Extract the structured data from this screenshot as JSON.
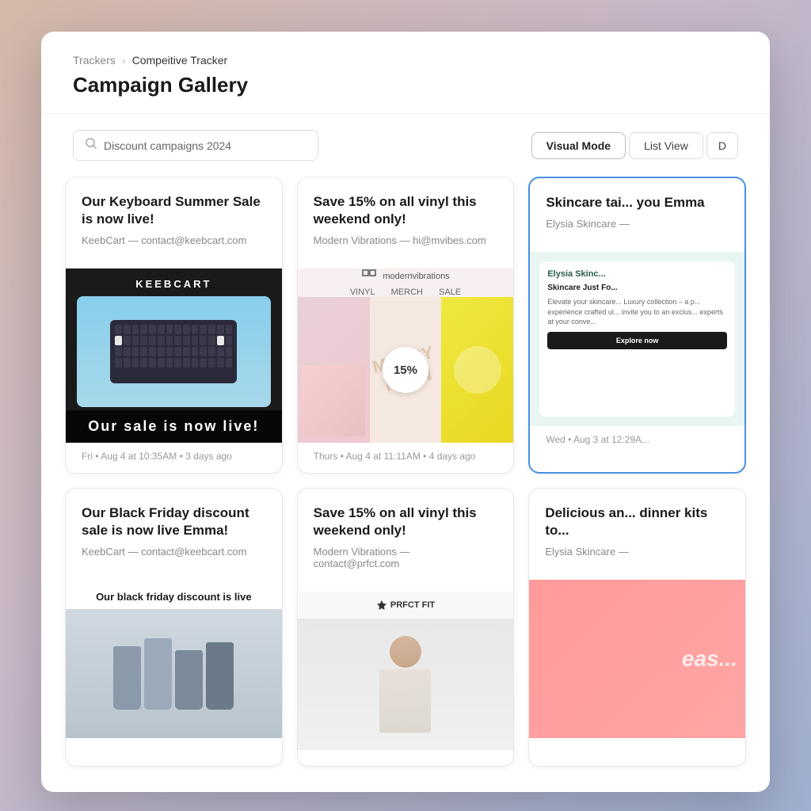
{
  "breadcrumb": {
    "parent": "Trackers",
    "separator": "›",
    "current": "Compeitive Tracker"
  },
  "page": {
    "title": "Campaign Gallery"
  },
  "search": {
    "placeholder": "Discount campaigns 2024",
    "value": "Discount campaigns 2024"
  },
  "toolbar": {
    "visual_mode": "Visual Mode",
    "list_view": "List View",
    "extra": "D"
  },
  "cards": [
    {
      "id": "card-1",
      "title": "Our Keyboard Summer Sale is now live!",
      "sender_name": "KeebCart",
      "sender_email": "contact@keebcart.com",
      "footer": "Fri  •  Aug 4 at 10:35AM  •  3 days ago",
      "image_type": "keyboard",
      "sale_text": "Our sale is now live!",
      "logo_text": "KEEBCART"
    },
    {
      "id": "card-2",
      "title": "Save 15% on all vinyl this weekend only!",
      "sender_name": "Modern Vibrations",
      "sender_email": "hi@mvibes.com",
      "footer": "Thurs  •  Aug 4 at 11:11AM  •  4 days ago",
      "image_type": "vinyl",
      "discount": "15%"
    },
    {
      "id": "card-3",
      "title": "Skincare tai... you Emma",
      "sender_name": "Elysia Skincare",
      "sender_email": "—",
      "footer": "Wed  •  Aug 3 at 12:29A...",
      "image_type": "skincare",
      "highlighted": true,
      "brand_label": "Elysia Skinc...",
      "headline": "Skincare Just Fo...",
      "body": "Elevate your skincare... Luxury collection – a p... experience crafted ul... invite you to an exclus... experts at your conve...",
      "cta": "Explore now"
    },
    {
      "id": "card-4",
      "title": "Our Black Friday discount sale is now live Emma!",
      "sender_name": "KeebCart",
      "sender_email": "contact@keebcart.com",
      "footer": "",
      "image_type": "black-friday",
      "bf_headline": "Our black friday discount is live"
    },
    {
      "id": "card-5",
      "title": "Save 15% on all vinyl this weekend only!",
      "sender_name": "Modern Vibrations",
      "sender_email": "contact@prfct.com",
      "footer": "",
      "image_type": "prfct"
    },
    {
      "id": "card-6",
      "title": "Delicious an... dinner kits to...",
      "sender_name": "Elysia Skincare",
      "sender_email": "—",
      "footer": "",
      "image_type": "delicious",
      "overlay_text": "eas..."
    }
  ]
}
